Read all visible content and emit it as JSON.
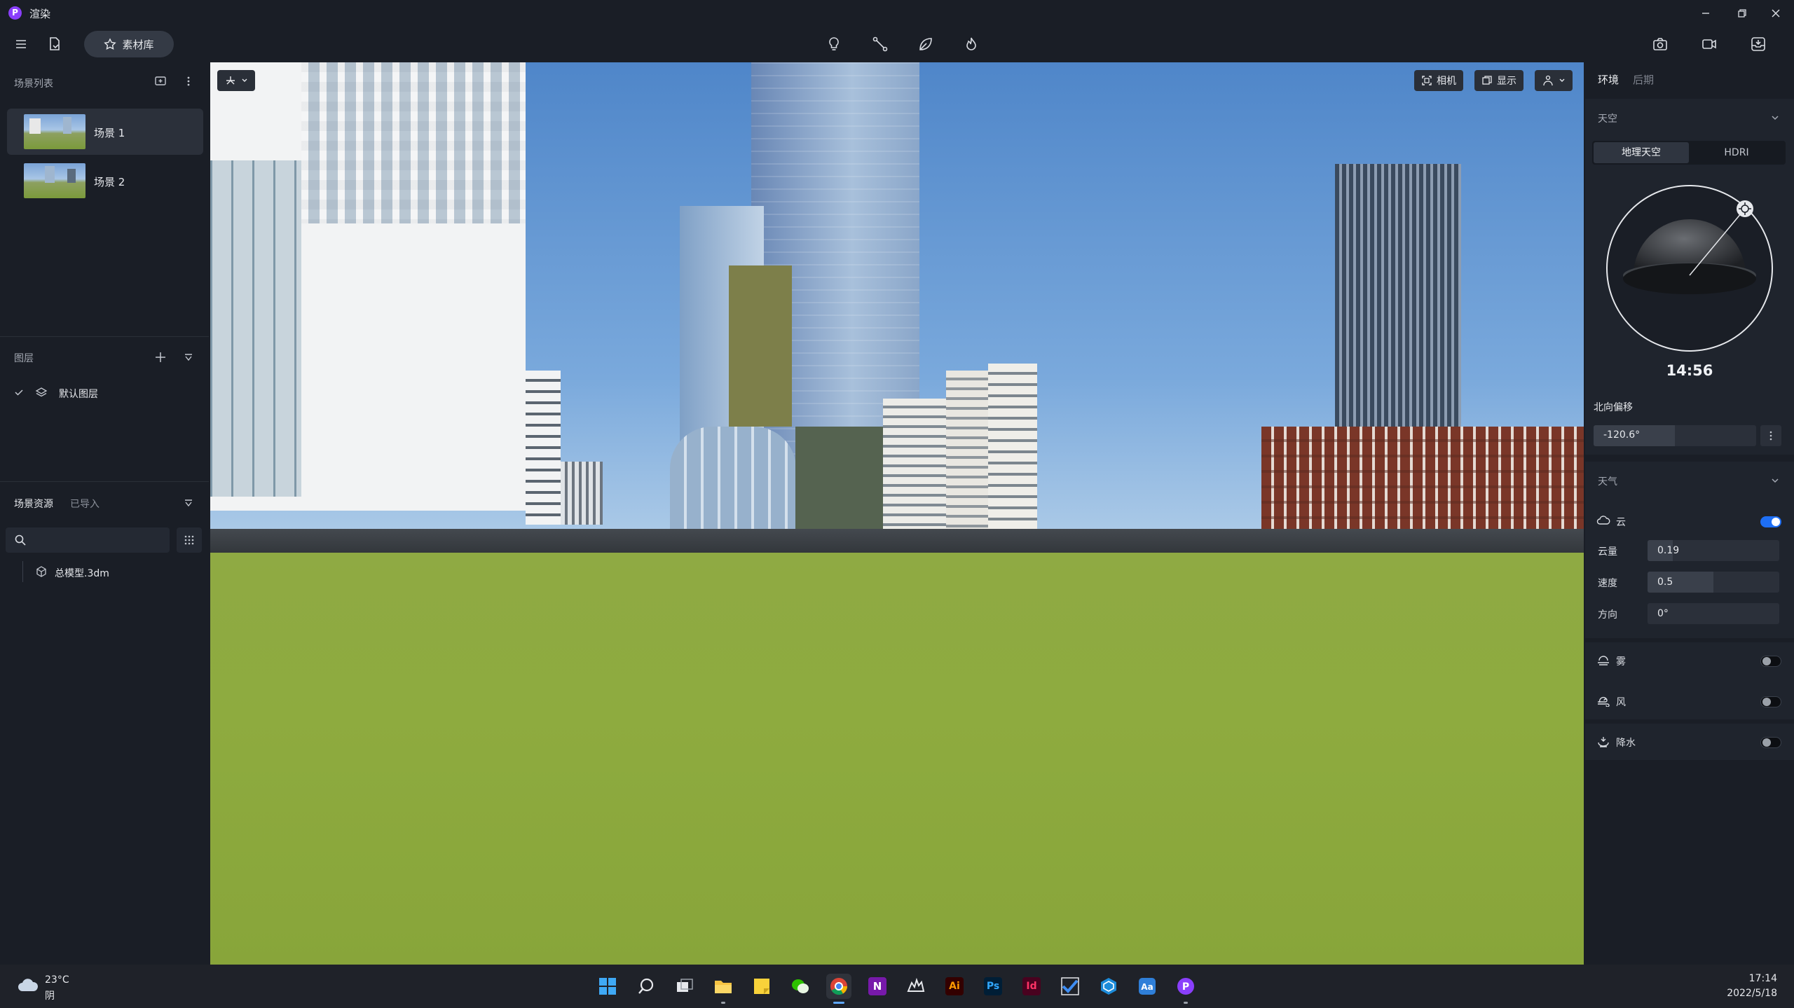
{
  "app": {
    "title": "渲染"
  },
  "toolbar": {
    "library_label": "素材库"
  },
  "scene_list": {
    "title": "场景列表",
    "items": [
      {
        "label": "场景 1",
        "active": true
      },
      {
        "label": "场景 2",
        "active": false
      }
    ]
  },
  "layers": {
    "title": "图层",
    "items": [
      {
        "label": "默认图层",
        "checked": true
      }
    ]
  },
  "resources": {
    "tab_active": "场景资源",
    "tab_other": "已导入",
    "search_placeholder": "",
    "items": [
      {
        "label": "总模型.3dm"
      }
    ]
  },
  "viewport": {
    "camera_label": "相机",
    "display_label": "显示"
  },
  "right_panel": {
    "tab_env": "环境",
    "tab_post": "后期",
    "sky": {
      "title": "天空",
      "mode_geo": "地理天空",
      "mode_hdri": "HDRI",
      "time": "14:56",
      "north_label": "北向偏移",
      "north_value": "-120.6°",
      "north_fraction": 0.5
    },
    "weather": {
      "title": "天气",
      "cloud_label": "云",
      "cloud_on": true,
      "amount_label": "云量",
      "amount_value": "0.19",
      "amount_fraction": 0.19,
      "speed_label": "速度",
      "speed_value": "0.5",
      "speed_fraction": 0.5,
      "direction_label": "方向",
      "direction_value": "0°",
      "direction_fraction": 0,
      "fog_label": "雾",
      "fog_on": false,
      "wind_label": "风",
      "wind_on": false,
      "rain_label": "降水",
      "rain_on": false
    }
  },
  "colors": {
    "accent": "#1e6ff5",
    "panel": "#1a1e26",
    "purple": "#8a3ffc"
  },
  "taskbar": {
    "weather_temp": "23°C",
    "weather_desc": "阴",
    "time": "17:14",
    "date": "2022/5/18",
    "apps": [
      "start-icon",
      "search-icon",
      "task-view-icon",
      "file-explorer-icon",
      "sticky-notes-icon",
      "wechat-icon",
      "chrome-icon",
      "onenote-icon",
      "rhino-icon",
      "illustrator-icon",
      "photoshop-icon",
      "indesign-icon",
      "todo-icon",
      "sketchup-icon",
      "dictionary-icon",
      "renderer-icon"
    ],
    "app_letters": {
      "onenote": "N",
      "illustrator": "Ai",
      "photoshop": "Ps",
      "indesign": "Id"
    }
  }
}
